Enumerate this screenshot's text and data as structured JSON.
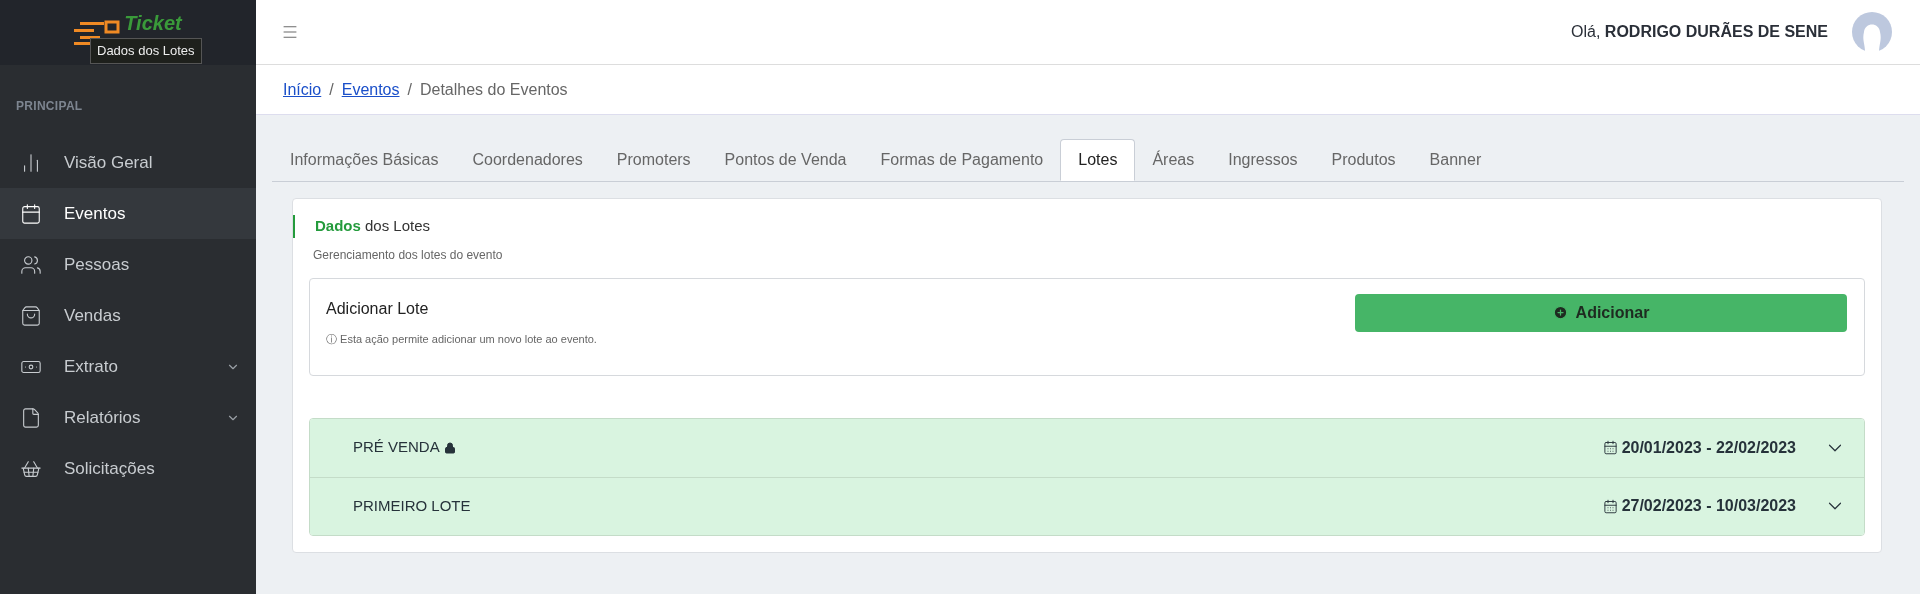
{
  "logo": {
    "text": "Ticket",
    "tooltip": "Dados dos Lotes"
  },
  "sidebar": {
    "section": "PRINCIPAL",
    "items": [
      {
        "label": "Visão Geral",
        "kind": "chart",
        "selected": false,
        "expandable": false
      },
      {
        "label": "Eventos",
        "kind": "calendar",
        "selected": true,
        "expandable": false
      },
      {
        "label": "Pessoas",
        "kind": "people",
        "selected": false,
        "expandable": false
      },
      {
        "label": "Vendas",
        "kind": "bag",
        "selected": false,
        "expandable": false
      },
      {
        "label": "Extrato",
        "kind": "money",
        "selected": false,
        "expandable": true
      },
      {
        "label": "Relatórios",
        "kind": "file",
        "selected": false,
        "expandable": true
      },
      {
        "label": "Solicitações",
        "kind": "basket",
        "selected": false,
        "expandable": false
      }
    ]
  },
  "header": {
    "greeting": "Olá,",
    "user": "RODRIGO DURÃES DE SENE"
  },
  "breadcrumb": [
    {
      "label": "Início",
      "kind": "link"
    },
    {
      "label": "/",
      "kind": "separator"
    },
    {
      "label": "Eventos",
      "kind": "link"
    },
    {
      "label": "/",
      "kind": "separator"
    },
    {
      "label": "Detalhes do Eventos",
      "kind": "current"
    }
  ],
  "tabs": [
    {
      "label": "Informações Básicas",
      "selected": false
    },
    {
      "label": "Coordenadores",
      "selected": false
    },
    {
      "label": "Promoters",
      "selected": false
    },
    {
      "label": "Pontos de Venda",
      "selected": false
    },
    {
      "label": "Formas de Pagamento",
      "selected": false
    },
    {
      "label": "Lotes",
      "selected": true
    },
    {
      "label": "Áreas",
      "selected": false
    },
    {
      "label": "Ingressos",
      "selected": false
    },
    {
      "label": "Produtos",
      "selected": false
    },
    {
      "label": "Banner",
      "selected": false
    }
  ],
  "card": {
    "title": "**Dados** dos Lotes",
    "subtitle": "Gerenciamento dos lotes do evento",
    "add": {
      "title": "Adicionar Lote",
      "hint": "ⓘ Esta ação permite adicionar um novo lote ao evento.",
      "button": "Adicionar"
    },
    "lots": [
      {
        "name": "PRÉ VENDA",
        "locked": true,
        "dates": "20/01/2023 - 22/02/2023",
        "expanded": false
      },
      {
        "name": "PRIMEIRO LOTE",
        "locked": false,
        "dates": "27/02/2023 - 10/03/2023",
        "expanded": false
      }
    ]
  }
}
